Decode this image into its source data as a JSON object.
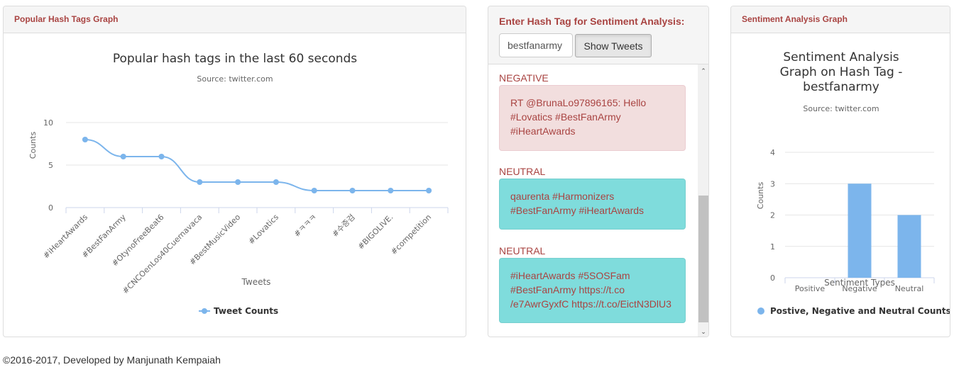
{
  "left_panel": {
    "heading": "Popular Hash Tags Graph",
    "chart_data": {
      "type": "line",
      "title": "Popular hash tags in the last 60 seconds",
      "subtitle": "Source: twitter.com",
      "xlabel": "Tweets",
      "ylabel": "Counts",
      "categories": [
        "#iHeartAwards",
        "#BestFanArmy",
        "#OtynoFreeBeat6",
        "#CNCOenLos40Cuernavaca",
        "#BestMusicVideo",
        "#Lovatics",
        "#ㅋㅋㅋ",
        "#수증검",
        "#BIGOLIVE.",
        "#competition"
      ],
      "series": [
        {
          "name": "Tweet Counts",
          "values": [
            8,
            6,
            6,
            3,
            3,
            3,
            2,
            2,
            2,
            2
          ]
        }
      ],
      "ylim": [
        0,
        10
      ],
      "yticks": [
        "0",
        "5",
        "10"
      ],
      "legend": "bottom",
      "color": "#7cb5ec"
    }
  },
  "middle_panel": {
    "title": "Enter Hash Tag for Sentiment Analysis:",
    "input_value": "bestfanarmy",
    "button_label": "Show Tweets",
    "scroll_up_glyph": "⌃",
    "scroll_down_glyph": "⌄",
    "tweets": [
      {
        "sentiment": "NEGATIVE",
        "text": "RT @BrunaLo97896165: Hello #Lovatics #BestFanArmy #iHeartAwards"
      },
      {
        "sentiment": "NEUTRAL",
        "text": "qaurenta #Harmonizers #BestFanArmy #iHeartAwards"
      },
      {
        "sentiment": "NEUTRAL",
        "text": "#iHeartAwards #5SOSFam #BestFanArmy https://t.co /e7AwrGyxfC https://t.co/EictN3DlU3"
      }
    ]
  },
  "right_panel": {
    "heading": "Sentiment Analysis Graph",
    "chart_data": {
      "type": "bar",
      "title_lines": [
        "Sentiment Analysis",
        "Graph on Hash Tag -",
        "bestfanarmy"
      ],
      "subtitle": "Source: twitter.com",
      "xlabel": "Sentiment Types",
      "ylabel": "Counts",
      "categories": [
        "Positive",
        "Negative",
        "Neutral"
      ],
      "series": [
        {
          "name": "Postive, Negative and Neutral Counts",
          "values": [
            0,
            3,
            2
          ]
        }
      ],
      "ylim": [
        0,
        4
      ],
      "yticks": [
        "0",
        "1",
        "2",
        "3",
        "4"
      ],
      "legend": "bottom",
      "color": "#7cb5ec"
    }
  },
  "footer": "©2016-2017, Developed by Manjunath Kempaiah"
}
